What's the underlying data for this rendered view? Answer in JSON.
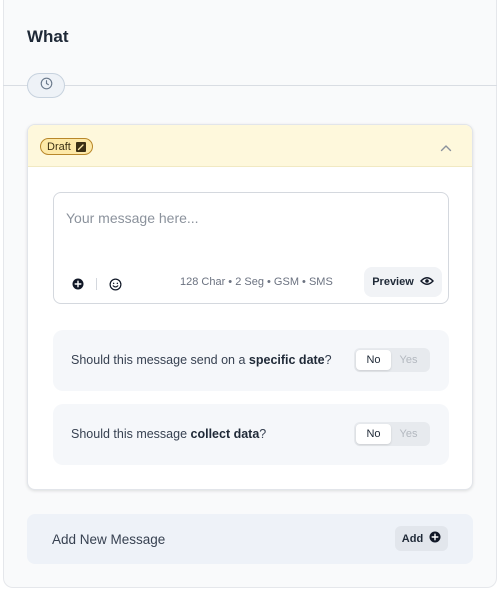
{
  "section": {
    "title": "What"
  },
  "message": {
    "status_badge": "Draft",
    "placeholder": "Your message here...",
    "meta": "128 Char • 2 Seg • GSM • SMS",
    "preview_label": "Preview"
  },
  "questions": [
    {
      "prefix": "Should this message send on a ",
      "emphasis": "specific date",
      "suffix": "?",
      "options": [
        "No",
        "Yes"
      ],
      "selected": "No"
    },
    {
      "prefix": "Should this message ",
      "emphasis": "collect data",
      "suffix": "?",
      "options": [
        "No",
        "Yes"
      ],
      "selected": "No"
    }
  ],
  "add_message": {
    "label": "Add New Message",
    "button_label": "Add"
  },
  "icons": [
    "clock-icon",
    "edit-icon",
    "chevron-up-icon",
    "add-circle-icon",
    "emoji-icon",
    "eye-icon"
  ],
  "colors": {
    "draft_bg": "#fde9a8",
    "header_bg": "#fef8dc",
    "panel_bg": "#eef2f8"
  }
}
